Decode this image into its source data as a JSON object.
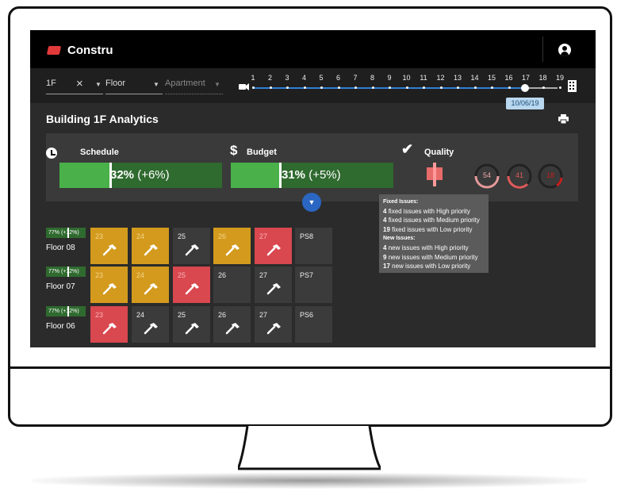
{
  "app": {
    "title": "Constru"
  },
  "filters": {
    "level": "1F",
    "floor_placeholder": "Floor",
    "apartment_placeholder": "Apartment"
  },
  "timeline": {
    "ticks": [
      "1",
      "2",
      "3",
      "4",
      "5",
      "6",
      "7",
      "8",
      "9",
      "10",
      "11",
      "12",
      "13",
      "14",
      "15",
      "16",
      "17",
      "18",
      "19"
    ],
    "selected_date": "10/06/19",
    "selected_tick": "17"
  },
  "section": {
    "title": "Building 1F Analytics"
  },
  "kpis": {
    "schedule": {
      "label": "Schedule",
      "percent": "32%",
      "delta": "(+6%)",
      "value": 32
    },
    "budget": {
      "label": "Budget",
      "percent": "31%",
      "delta": "(+5%)",
      "value": 31
    },
    "quality": {
      "label": "Quality",
      "gauges": [
        "54",
        "41",
        "18"
      ]
    }
  },
  "tooltip": {
    "fixed_header": "Fixed Issues:",
    "fixed": [
      {
        "count": "4",
        "text": "fixed issues with High priority"
      },
      {
        "count": "4",
        "text": "fixed issues with Medium priority"
      },
      {
        "count": "19",
        "text": "fixed issues with Low priority"
      }
    ],
    "new_header": "New Issues:",
    "new": [
      {
        "count": "4",
        "text": "new issues with High priority"
      },
      {
        "count": "9",
        "text": "new issues with Medium priority"
      },
      {
        "count": "17",
        "text": "new issues with Low priority"
      }
    ]
  },
  "floors": [
    {
      "name": "Floor 08",
      "progress_label": "77% (+12%)",
      "units": [
        {
          "num": "23",
          "status": "yellow"
        },
        {
          "num": "24",
          "status": "yellow"
        },
        {
          "num": "25",
          "status": "grey"
        },
        {
          "num": "26",
          "status": "yellow"
        },
        {
          "num": "27",
          "status": "red"
        },
        {
          "num": "PS8",
          "status": "plain"
        }
      ]
    },
    {
      "name": "Floor 07",
      "progress_label": "77% (+12%)",
      "units": [
        {
          "num": "23",
          "status": "yellow"
        },
        {
          "num": "24",
          "status": "yellow"
        },
        {
          "num": "25",
          "status": "red"
        },
        {
          "num": "26",
          "status": "plain"
        },
        {
          "num": "27",
          "status": "grey"
        },
        {
          "num": "PS7",
          "status": "plain"
        }
      ]
    },
    {
      "name": "Floor 06",
      "progress_label": "77% (+12%)",
      "units": [
        {
          "num": "23",
          "status": "red"
        },
        {
          "num": "24",
          "status": "grey"
        },
        {
          "num": "25",
          "status": "grey"
        },
        {
          "num": "26",
          "status": "grey"
        },
        {
          "num": "27",
          "status": "grey"
        },
        {
          "num": "PS6",
          "status": "plain"
        }
      ]
    }
  ],
  "colors": {
    "accent_blue": "#2f7fd6",
    "progress_green": "#49b04a",
    "warning_yellow": "#d39a1d",
    "danger_red": "#d9474f"
  }
}
